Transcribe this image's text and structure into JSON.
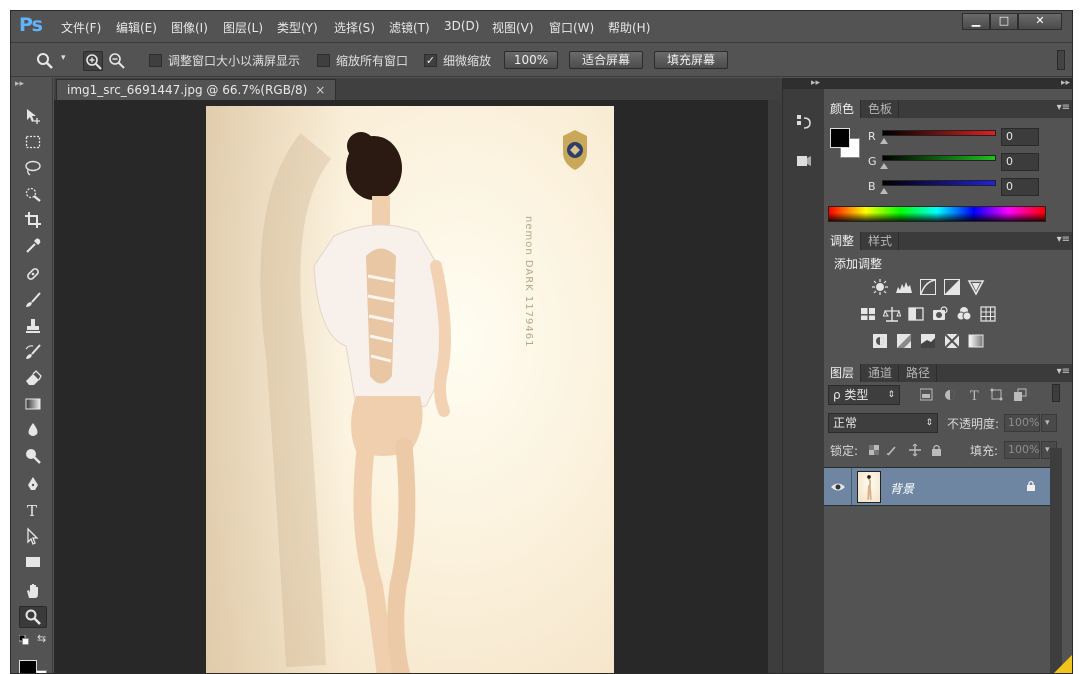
{
  "app": {
    "logo": "Ps"
  },
  "menu": [
    "文件(F)",
    "编辑(E)",
    "图像(I)",
    "图层(L)",
    "类型(Y)",
    "选择(S)",
    "滤镜(T)",
    "3D(D)",
    "视图(V)",
    "窗口(W)",
    "帮助(H)"
  ],
  "window_controls": {
    "minimize": "▁",
    "maximize": "□",
    "close": "✕"
  },
  "options": {
    "resize_windows": {
      "label": "调整窗口大小以满屏显示",
      "checked": false
    },
    "zoom_all": {
      "label": "缩放所有窗口",
      "checked": false
    },
    "scrubby_zoom": {
      "label": "细微缩放",
      "checked": true
    },
    "btn_100": "100%",
    "btn_fit": "适合屏幕",
    "btn_fill": "填充屏幕"
  },
  "document": {
    "tab_title": "img1_src_6691447.jpg @ 66.7%(RGB/8)",
    "tab_close": "×",
    "brand_text": "nemon  DARK 1179461"
  },
  "panels": {
    "collapse_glyph": "▸▸",
    "menu_glyph": "▾≡",
    "color_tabs": [
      "颜色",
      "色板"
    ],
    "color": {
      "channels": [
        {
          "name": "R",
          "value": "0",
          "color": "#e02020"
        },
        {
          "name": "G",
          "value": "0",
          "color": "#20c020"
        },
        {
          "name": "B",
          "value": "0",
          "color": "#2020e0"
        }
      ],
      "foreground": "#000000",
      "background": "#ffffff"
    },
    "adjust_tabs": [
      "调整",
      "样式"
    ],
    "adjust_title": "添加调整",
    "layers_tabs": [
      "图层",
      "通道",
      "路径"
    ],
    "layers": {
      "filter_kind": "ρ 类型",
      "blend_mode": "正常",
      "opacity_label": "不透明度:",
      "opacity_value": "100%",
      "lock_label": "锁定:",
      "fill_label": "填充:",
      "fill_value": "100%",
      "items": [
        {
          "name": "背景",
          "locked": true,
          "visible": true
        }
      ]
    }
  }
}
